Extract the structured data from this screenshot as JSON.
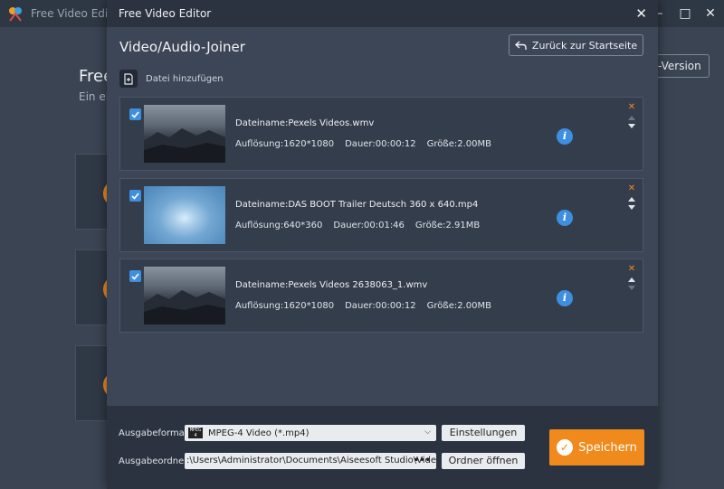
{
  "background": {
    "title": "Free Video Edito",
    "heading": "Free",
    "subheading": "Ein ei",
    "version_button": "-Version",
    "window_controls": [
      "minimize-icon",
      "maximize-icon",
      "close-icon"
    ]
  },
  "dialog": {
    "title": "Free Video Editor",
    "header": "Video/Audio-Joiner",
    "back_button": "Zurück zur Startseite",
    "add_file": "Datei hinzufügen",
    "files": [
      {
        "name": "Dateiname:Pexels Videos.wmv",
        "resolution": "Auflösung:1620*1080",
        "duration": "Dauer:00:00:12",
        "size": "Größe:2.00MB",
        "thumbnail": "landscape",
        "checked": true
      },
      {
        "name": "Dateiname:DAS BOOT  Trailer Deutsch 360 x 640.mp4",
        "resolution": "Auflösung:640*360",
        "duration": "Dauer:00:01:46",
        "size": "Größe:2.91MB",
        "thumbnail": "blue",
        "checked": true
      },
      {
        "name": "Dateiname:Pexels Videos 2638063_1.wmv",
        "resolution": "Auflösung:1620*1080",
        "duration": "Dauer:00:00:12",
        "size": "Größe:2.00MB",
        "thumbnail": "landscape",
        "checked": true
      }
    ],
    "output": {
      "format_label": "Ausgabeformat:",
      "format_value": "MPEG-4 Video (*.mp4)",
      "format_icon_text": "MPEG 4",
      "settings_button": "Einstellungen",
      "folder_label": "Ausgabeordner:",
      "folder_value": ":\\Users\\Administrator\\Documents\\Aiseesoft Studio\\Video",
      "folder_browse": "•••",
      "open_folder_button": "Ordner öffnen",
      "save_button": "Speichern"
    }
  },
  "colors": {
    "accent_orange": "#f08a1d",
    "accent_blue": "#3f8fe0",
    "dialog_bg": "#3d4656",
    "titlebar_bg": "#2b3340"
  }
}
